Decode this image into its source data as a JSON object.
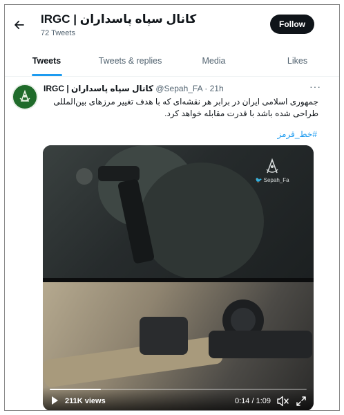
{
  "header": {
    "back_icon": "arrow-left-icon",
    "title": "IRGC | کانال سپاه پاسداران",
    "tweet_count": "72 Tweets",
    "follow_label": "Follow"
  },
  "tabs": [
    {
      "label": "Tweets",
      "active": true
    },
    {
      "label": "Tweets & replies",
      "active": false
    },
    {
      "label": "Media",
      "active": false
    },
    {
      "label": "Likes",
      "active": false
    }
  ],
  "tweet": {
    "display_name": "IRGC | کانال سپاه پاسداران",
    "handle": "@Sepah_FA · 21h",
    "text": "جمهوری اسلامی ایران در برابر هر نقشه‌ای که با هدف تغییر مرزهای بین‌المللی طراحی شده باشد با قدرت مقابله خواهد کرد.",
    "hashtag": "#خط_قرمز",
    "more_label": "···"
  },
  "video": {
    "watermark": "Sepah_Fa",
    "views": "211K views",
    "time": "0:14 / 1:09",
    "progress": 0.2,
    "icons": {
      "play": "play-icon",
      "mute": "mute-icon",
      "fullscreen": "fullscreen-icon"
    }
  },
  "colors": {
    "accent": "#1d9bf0",
    "text": "#0f1419",
    "muted": "#536471",
    "follow_bg": "#0f1419"
  }
}
